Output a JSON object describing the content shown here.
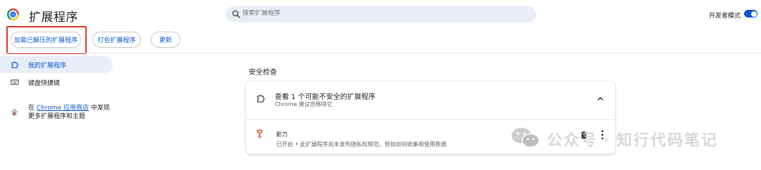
{
  "header": {
    "title": "扩展程序",
    "search_placeholder": "搜索扩展程序",
    "dev_mode_label": "开发者模式",
    "dev_mode_on": true
  },
  "toolbar": {
    "load_unpacked": "加载已解压的扩展程序",
    "pack": "打包扩展程序",
    "update": "更新"
  },
  "sidebar": {
    "items": [
      {
        "label": "我的扩展程序",
        "icon": "puzzle-icon",
        "active": true
      },
      {
        "label": "键盘快捷键",
        "icon": "keyboard-icon",
        "active": false
      }
    ],
    "store_prefix": "在 ",
    "store_link": "Chrome 应用商店",
    "store_suffix": " 中发现更多扩展程序和主题"
  },
  "main": {
    "section_title": "安全检查",
    "card": {
      "title": "查看 1 个可能不安全的扩展程序",
      "subtitle": "Chrome 建议您移除它",
      "extension": {
        "name": "影刀",
        "description": "已开启 • 此扩展程序尚未发布隐私权规范，例如如何收集和使用数据"
      }
    }
  },
  "watermark": {
    "text": "公众号 · 知行代码笔记"
  },
  "colors": {
    "accent": "#0b57d0",
    "highlight": "#e4331f",
    "active_bg": "#e8edf7"
  }
}
